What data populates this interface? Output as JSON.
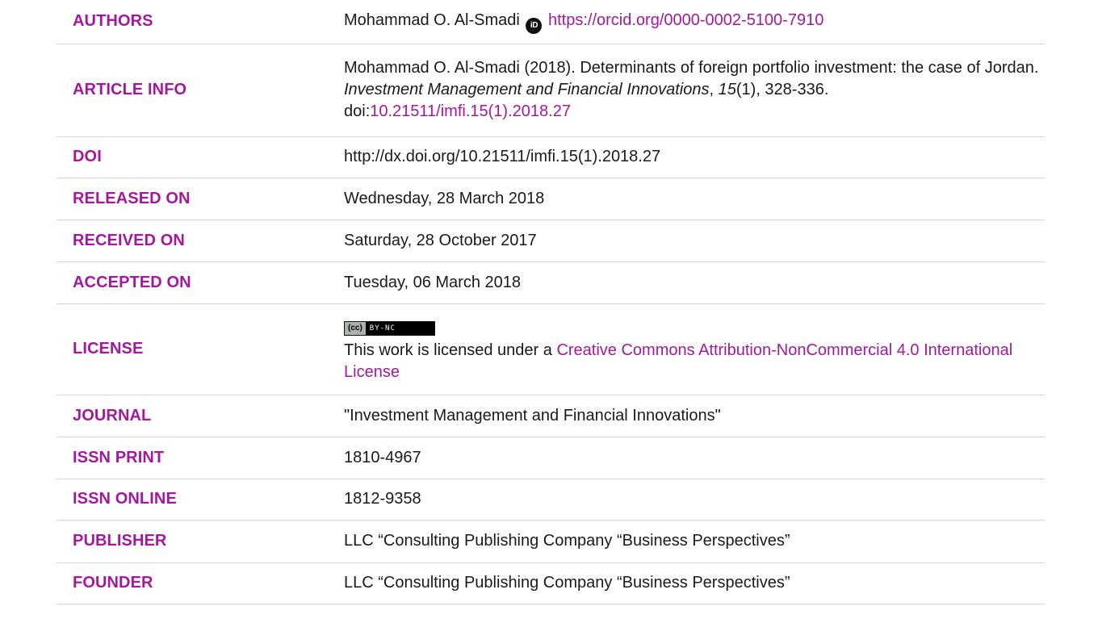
{
  "authors": {
    "label": "AUTHORS",
    "name": "Mohammad O. Al-Smadi",
    "orcid_icon": "orcid-icon",
    "orcid_icon_text": "iD",
    "orcid_url": "https://orcid.org/0000-0002-5100-7910"
  },
  "article_info": {
    "label": "ARTICLE INFO",
    "citation_prefix": "Mohammad O. Al-Smadi (2018). Determinants of foreign portfolio investment: the case of Jordan. ",
    "journal_italic": "Investment Management and Financial Innovations",
    "comma": ", ",
    "volume_italic": "15",
    "issue_pages": "(1), 328-336. doi:",
    "doi_link": "10.21511/imfi.15(1).2018.27"
  },
  "doi": {
    "label": "DOI",
    "value": "http://dx.doi.org/10.21511/imfi.15(1).2018.27"
  },
  "released_on": {
    "label": "RELEASED ON",
    "value": "Wednesday, 28 March 2018"
  },
  "received_on": {
    "label": "RECEIVED ON",
    "value": "Saturday, 28 October 2017"
  },
  "accepted_on": {
    "label": "ACCEPTED ON",
    "value": "Tuesday, 06 March 2018"
  },
  "license": {
    "label": "LICENSE",
    "badge_logo": "(cc)",
    "badge_text": "BY-NC",
    "text_prefix": "This work is licensed under a ",
    "link": "Creative Commons Attribution-NonCommercial 4.0 International License"
  },
  "journal": {
    "label": "JOURNAL",
    "value": "\"Investment Management and Financial Innovations\""
  },
  "issn_print": {
    "label": "ISSN PRINT",
    "value": "1810-4967"
  },
  "issn_online": {
    "label": "ISSN ONLINE",
    "value": "1812-9358"
  },
  "publisher": {
    "label": "PUBLISHER",
    "value": "LLC “Consulting Publishing Company “Business Perspectives”"
  },
  "founder": {
    "label": "FOUNDER",
    "value": "LLC “Consulting Publishing Company “Business Perspectives”"
  },
  "colors": {
    "accent": "#a3199e",
    "text": "#1a1a1a",
    "divider": "#d4d4d4"
  }
}
